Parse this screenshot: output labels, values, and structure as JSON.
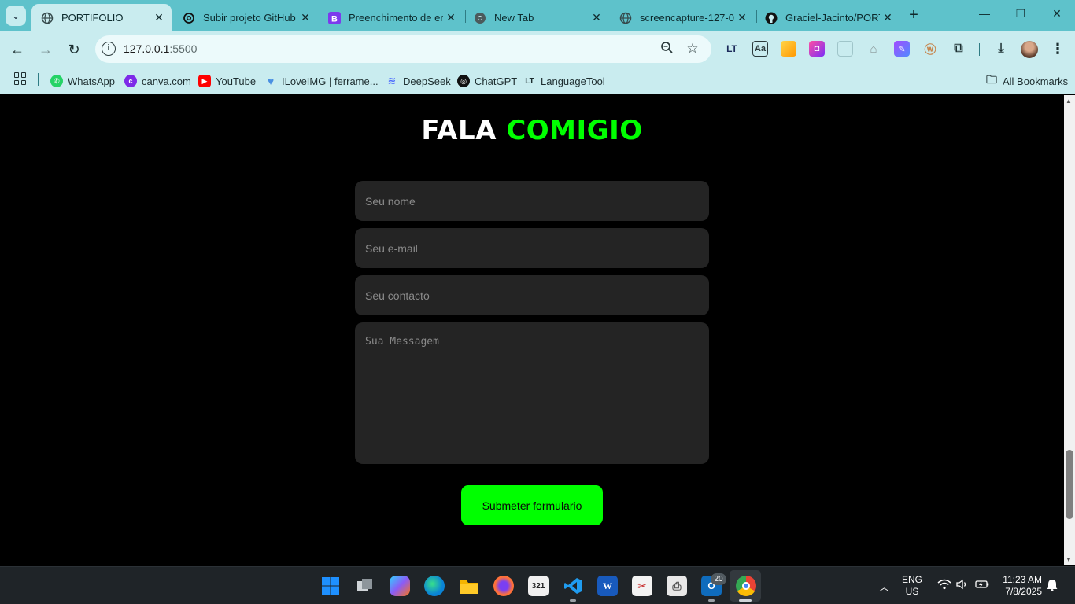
{
  "browser": {
    "tabs": [
      {
        "title": "PORTIFOLIO",
        "active": true,
        "icon": "globe-icon"
      },
      {
        "title": "Subir projeto GitHub",
        "active": false,
        "icon": "chatgpt-icon"
      },
      {
        "title": "Preenchimento de en",
        "active": false,
        "icon": "bootstrap-icon"
      },
      {
        "title": "New Tab",
        "active": false,
        "icon": "chrome-icon"
      },
      {
        "title": "screencapture-127-0",
        "active": false,
        "icon": "globe-icon"
      },
      {
        "title": "Graciel-Jacinto/PORT",
        "active": false,
        "icon": "github-icon"
      }
    ],
    "url_host": "127.0.0.1",
    "url_port": ":5500",
    "bookmarks": [
      {
        "label": "WhatsApp",
        "color": "#25d366"
      },
      {
        "label": "canva.com",
        "color": "#7d2ae8"
      },
      {
        "label": "YouTube",
        "color": "#ff0000"
      },
      {
        "label": "ILoveIMG | ferrame...",
        "color": "#4a90e2"
      },
      {
        "label": "DeepSeek",
        "color": "#4d6bfe"
      },
      {
        "label": "ChatGPT",
        "color": "#111111"
      },
      {
        "label": "LanguageTool",
        "color": "#1d2d2f"
      }
    ],
    "all_bookmarks": "All Bookmarks"
  },
  "page": {
    "heading_white": "FALA",
    "heading_green": "COMIGIO",
    "name_placeholder": "Seu nome",
    "email_placeholder": "Seu e-mail",
    "contact_placeholder": "Seu contacto",
    "message_placeholder": "Sua Messagem",
    "submit_label": "Submeter formulario",
    "accent_color": "#00ff00"
  },
  "taskbar": {
    "language": "ENG",
    "region": "US",
    "time": "11:23 AM",
    "date": "7/8/2025",
    "mail_badge": "20"
  }
}
